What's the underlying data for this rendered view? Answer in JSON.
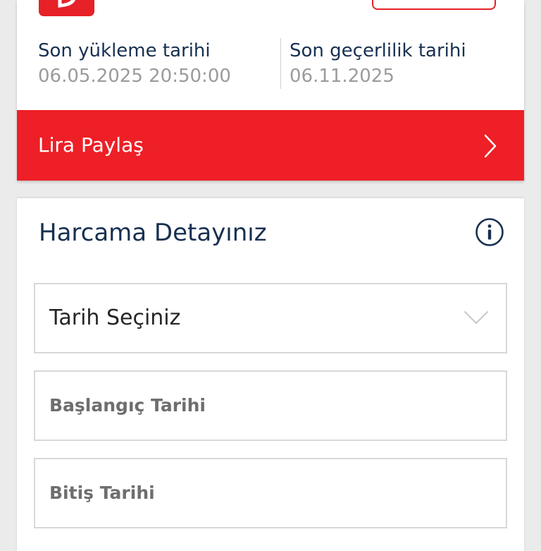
{
  "top_card": {
    "load_label": "Son yükleme tarihi",
    "load_value": "06.05.2025 20:50:00",
    "expiry_label": "Son geçerlilik tarihi",
    "expiry_value": "06.11.2025",
    "share_label": "Lira Paylaş",
    "share_icon": "chevron-right-icon"
  },
  "spending_detail": {
    "title": "Harcama Detayınız",
    "info_icon": "info-icon",
    "date_select_label": "Tarih Seçiniz",
    "date_select_icon": "chevron-down-icon",
    "start_date_placeholder": "Başlangıç Tarihi",
    "end_date_placeholder": "Bitiş Tarihi"
  },
  "colors": {
    "brand_red": "#ee1f26",
    "title_navy": "#173051",
    "muted_gray": "#9b9b9b",
    "border_gray": "#d8d8d8"
  }
}
